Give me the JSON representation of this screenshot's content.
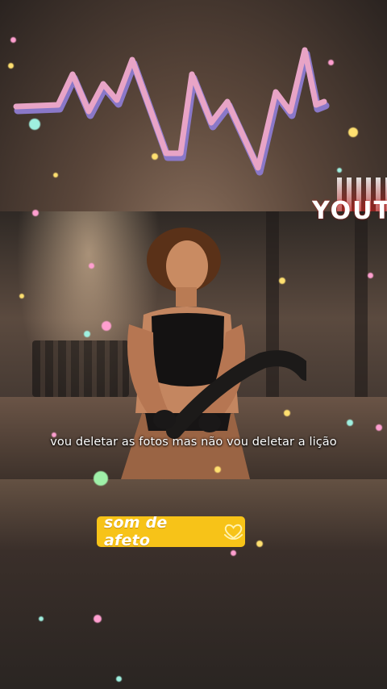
{
  "video": {
    "subtitle": "vou deletar as fotos mas não vou deletar a lição",
    "corner_text": "YOUT"
  },
  "badge": {
    "label": "som de afeto",
    "icon": "heart-hands-icon",
    "color": "#f7c318"
  },
  "colors": {
    "heartbeat_line": "#e8a4c6",
    "heartbeat_shadow": "#8a78c8"
  }
}
